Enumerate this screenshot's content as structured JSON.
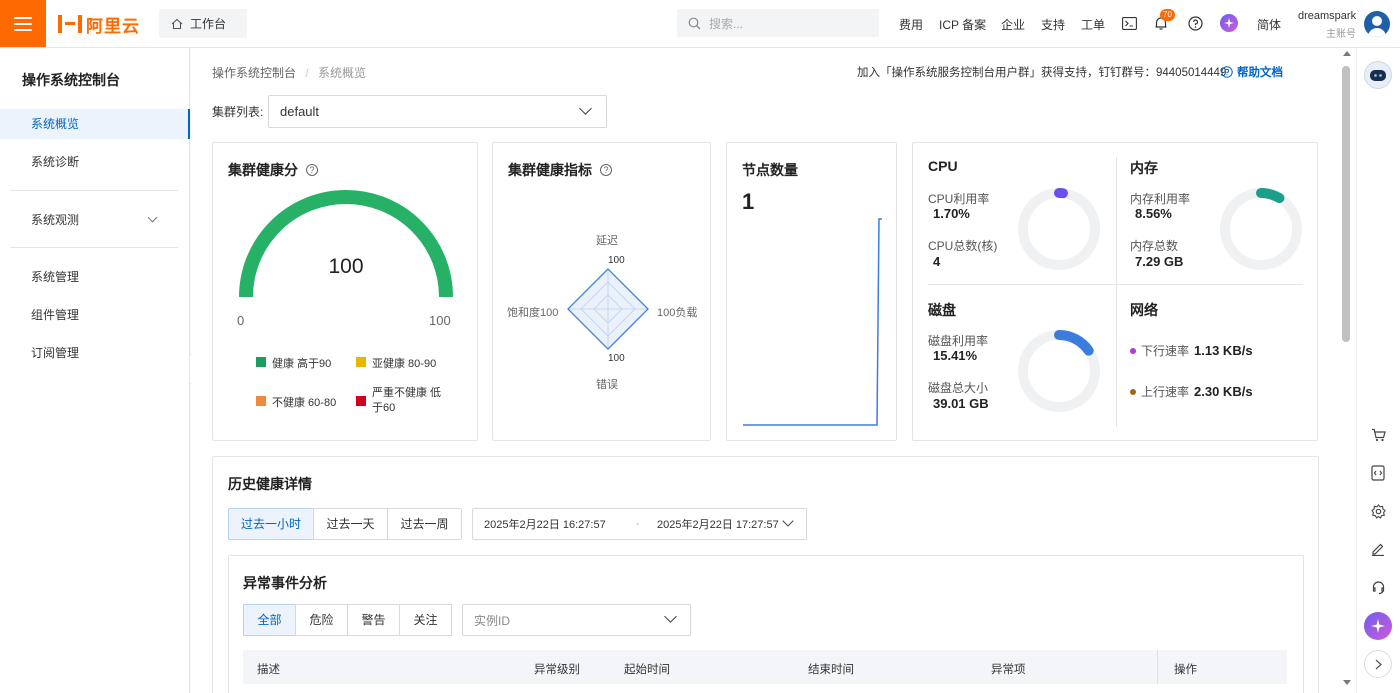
{
  "topbar": {
    "logo_text": "阿里云",
    "workbench": "工作台",
    "search_placeholder": "搜索...",
    "nav": [
      "费用",
      "ICP 备案",
      "企业",
      "支持",
      "工单"
    ],
    "notification_count": "70",
    "language": "简体",
    "username": "dreamspark",
    "account_type": "主账号"
  },
  "sidebar": {
    "title": "操作系统控制台",
    "items": [
      {
        "label": "系统概览",
        "active": true
      },
      {
        "label": "系统诊断"
      },
      {
        "label": "系统观测",
        "expandable": true
      },
      {
        "label": "系统管理"
      },
      {
        "label": "组件管理"
      },
      {
        "label": "订阅管理"
      }
    ]
  },
  "breadcrumb": {
    "root": "操作系统控制台",
    "sep": "/",
    "current": "系统概览"
  },
  "support": {
    "text": "加入「操作系统服务控制台用户群」获得支持，钉钉群号：94405014449",
    "help": "帮助文档"
  },
  "cluster": {
    "label": "集群列表:",
    "value": "default"
  },
  "health_score": {
    "title": "集群健康分",
    "value": "100",
    "min": "0",
    "max": "100",
    "legend": [
      {
        "label": "健康 高于90",
        "color": "#1a9e5f"
      },
      {
        "label": "亚健康 80-90",
        "color": "#e6b800"
      },
      {
        "label": "不健康 60-80",
        "color": "#f08a3a"
      },
      {
        "label": "严重不健康 低于60",
        "color": "#d0021b"
      }
    ]
  },
  "health_metrics": {
    "title": "集群健康指标",
    "top": "延迟",
    "top_value": "100",
    "right": "100负载",
    "bottom": "错误",
    "bottom_value": "100",
    "left": "饱和度100"
  },
  "nodes": {
    "title": "节点数量",
    "value": "1"
  },
  "cpu": {
    "title": "CPU",
    "usage_label": "CPU利用率",
    "usage": "1.70%",
    "usage_pct": 1.7,
    "count_label": "CPU总数(核)",
    "count": "4",
    "color": "#6a4ef0"
  },
  "memory": {
    "title": "内存",
    "usage_label": "内存利用率",
    "usage": "8.56%",
    "usage_pct": 8.56,
    "total_label": "内存总数",
    "total": "7.29 GB",
    "color": "#1c9e8a"
  },
  "disk": {
    "title": "磁盘",
    "usage_label": "磁盘利用率",
    "usage": "15.41%",
    "usage_pct": 15.41,
    "total_label": "磁盘总大小",
    "total": "39.01 GB",
    "color": "#3b7ddd"
  },
  "network": {
    "title": "网络",
    "down_label": "下行速率",
    "down": "1.13 KB/s",
    "down_color": "#b03ad6",
    "up_label": "上行速率",
    "up": "2.30 KB/s",
    "up_color": "#a0671c"
  },
  "history": {
    "title": "历史健康详情",
    "ranges": [
      "过去一小时",
      "过去一天",
      "过去一周"
    ],
    "start": "2025年2月22日 16:27:57",
    "sep": "-",
    "end": "2025年2月22日 17:27:57"
  },
  "events": {
    "title": "异常事件分析",
    "filters": [
      "全部",
      "危险",
      "警告",
      "关注"
    ],
    "instance_placeholder": "实例ID",
    "columns": [
      "描述",
      "异常级别",
      "起始时间",
      "结束时间",
      "异常项",
      "操作"
    ]
  }
}
